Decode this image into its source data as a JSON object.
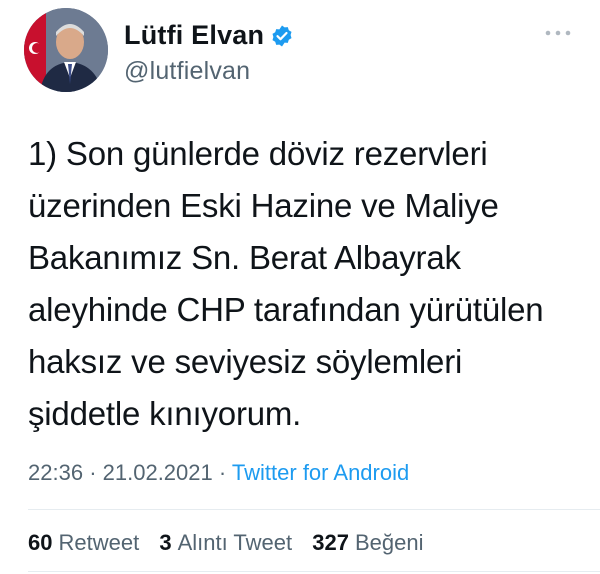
{
  "author": {
    "display_name": "Lütfi Elvan",
    "handle": "@lutfielvan",
    "verified": true,
    "verified_color": "#1d9bf0"
  },
  "tweet": {
    "text_lines": [
      "1) Son günlerde döviz rezervleri",
      "üzerinden Eski Hazine ve Maliye",
      "Bakanımız Sn. Berat Albayrak",
      "aleyhinde CHP tarafından yürütülen",
      "haksız ve seviyesiz söylemleri",
      "şiddetle kınıyorum."
    ]
  },
  "meta": {
    "time": "22:36",
    "separator": "·",
    "date": "21.02.2021",
    "source": "Twitter for Android"
  },
  "stats": {
    "retweets_count": "60",
    "retweets_label": "Retweet",
    "quotes_count": "3",
    "quotes_label": "Alıntı Tweet",
    "likes_count": "327",
    "likes_label": "Beğeni"
  },
  "icons": {
    "more": "more-horizontal-icon",
    "verified": "verified-badge-icon"
  },
  "colors": {
    "text": "#0f1419",
    "secondary": "#536471",
    "link": "#1d9bf0"
  }
}
